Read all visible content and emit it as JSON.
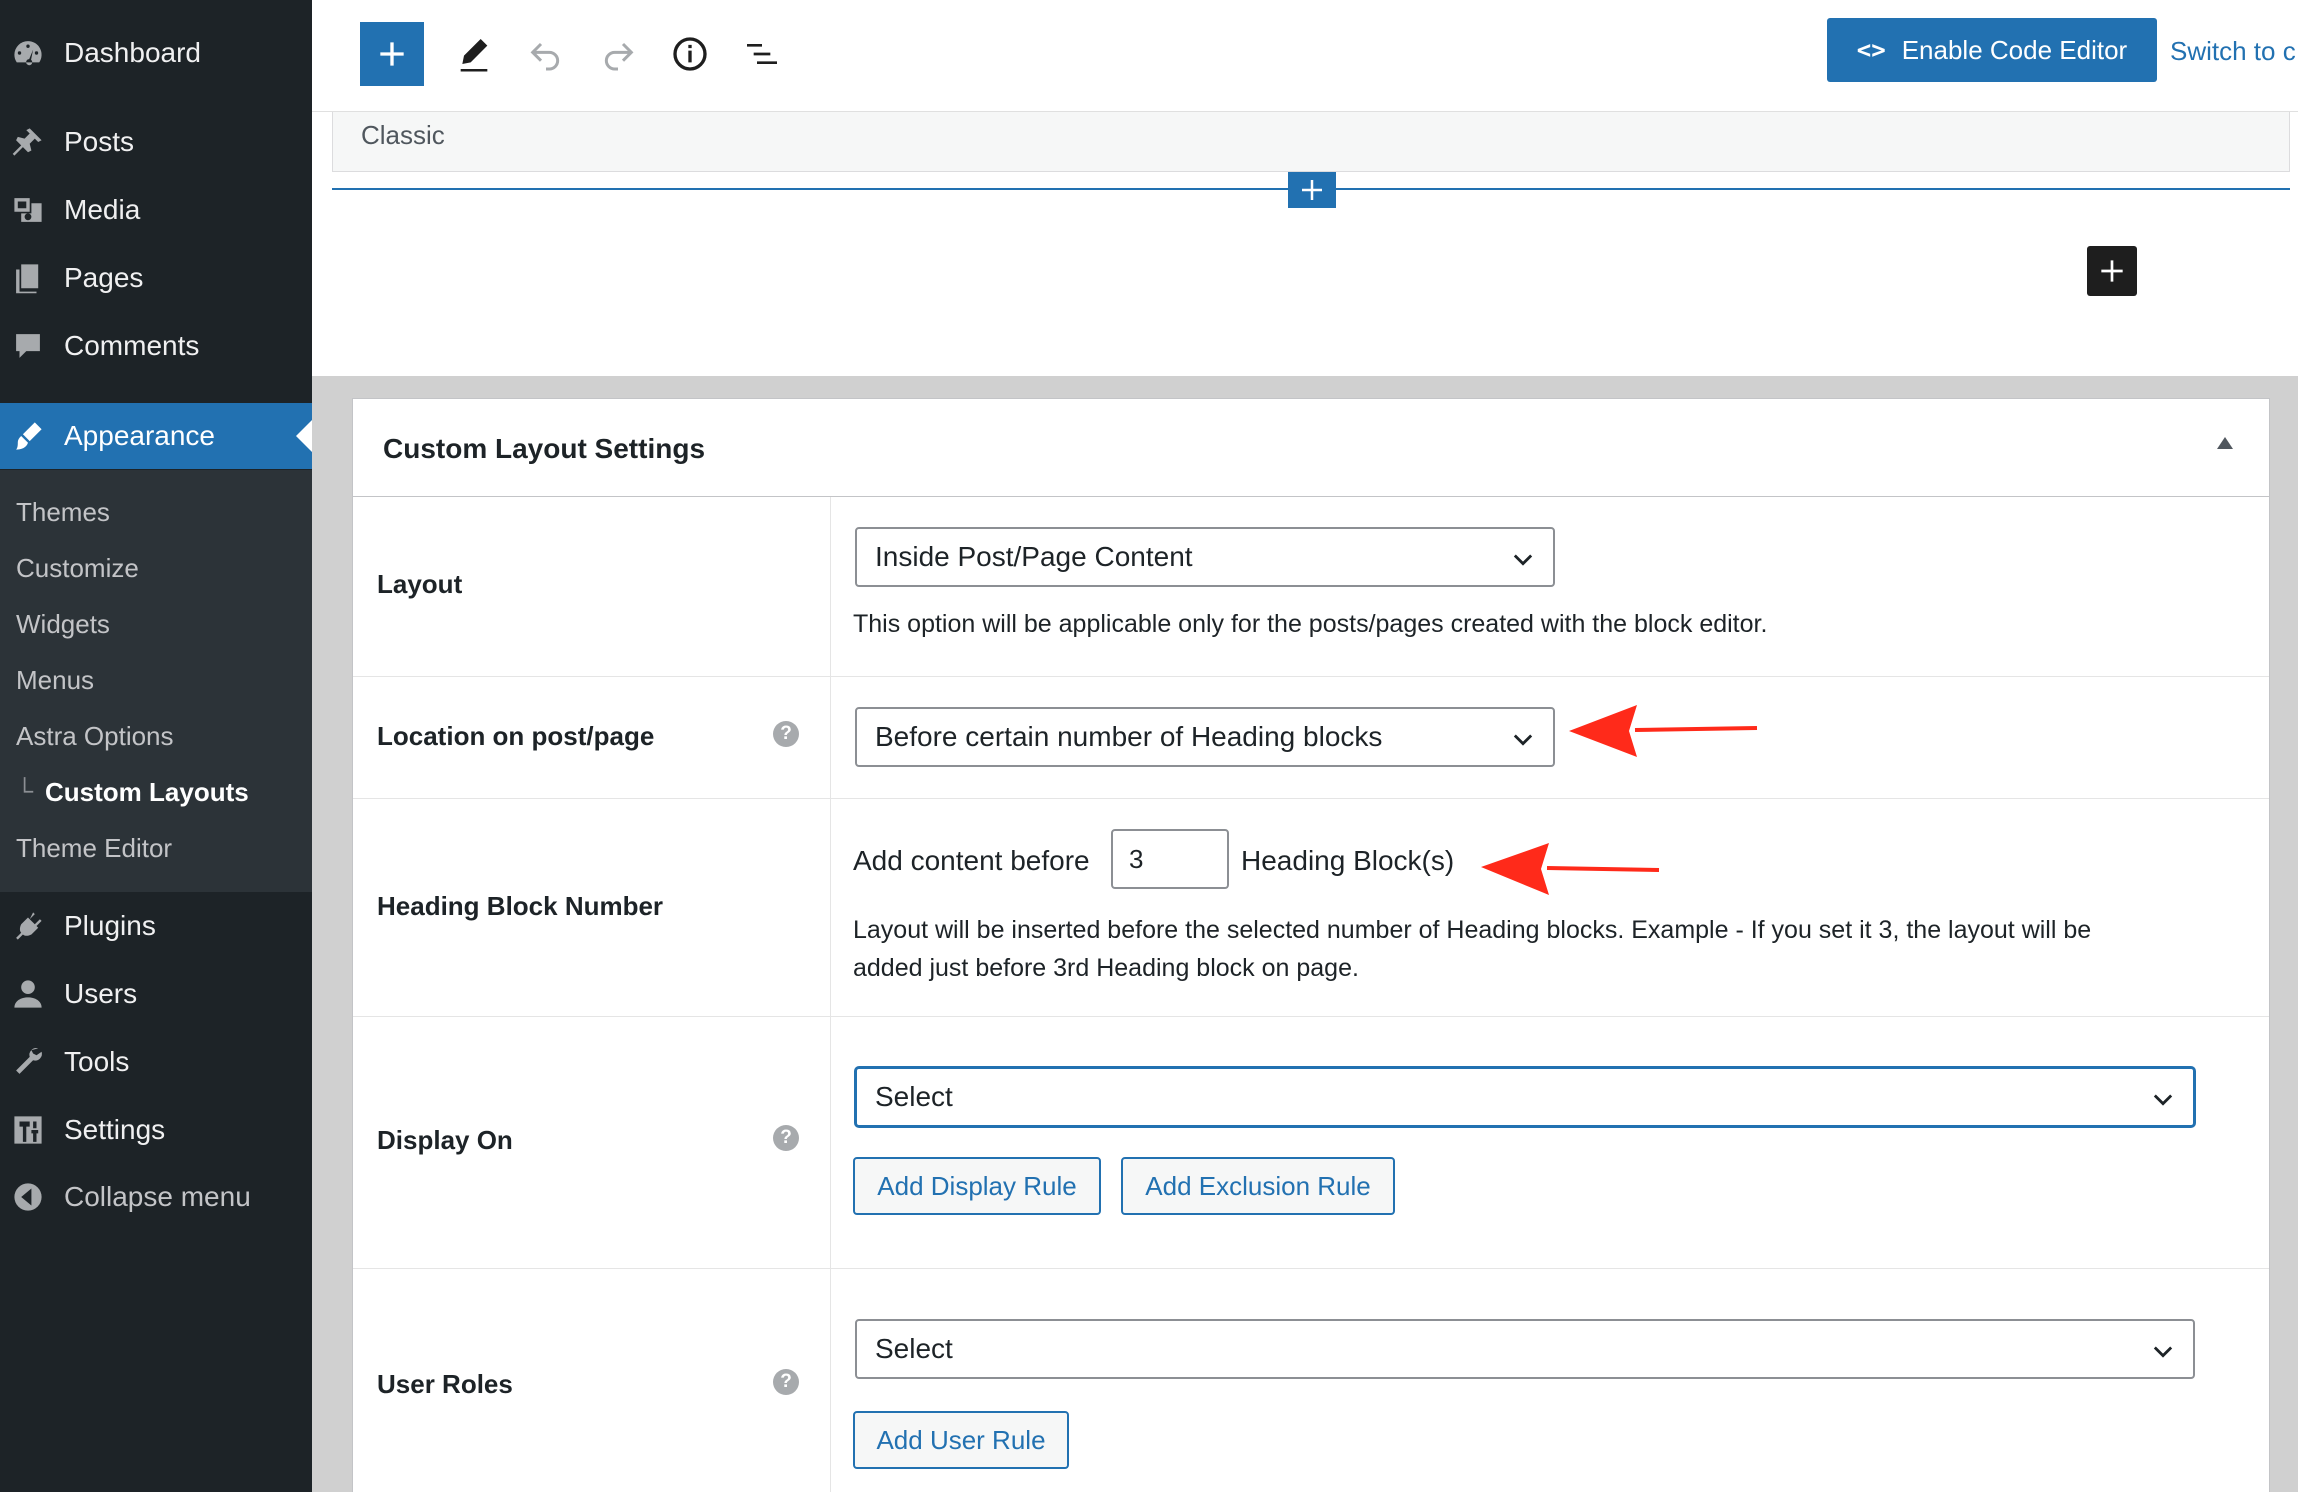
{
  "sidebar": {
    "items_top": [
      {
        "label": "Dashboard",
        "icon": "dashboard-icon"
      },
      {
        "label": "Posts",
        "icon": "pin-icon"
      },
      {
        "label": "Media",
        "icon": "media-icon"
      },
      {
        "label": "Pages",
        "icon": "pages-icon"
      },
      {
        "label": "Comments",
        "icon": "comments-icon"
      }
    ],
    "active": {
      "label": "Appearance",
      "icon": "paintbrush-icon"
    },
    "submenu": [
      "Themes",
      "Customize",
      "Widgets",
      "Menus",
      "Astra Options",
      "Custom Layouts",
      "Theme Editor"
    ],
    "items_bottom": [
      {
        "label": "Plugins",
        "icon": "plugins-icon"
      },
      {
        "label": "Users",
        "icon": "users-icon"
      },
      {
        "label": "Tools",
        "icon": "tools-icon"
      },
      {
        "label": "Settings",
        "icon": "settings-icon"
      }
    ],
    "collapse": "Collapse menu"
  },
  "toolbar": {
    "enable_code_editor": "Enable Code Editor",
    "switch_to": "Switch to c"
  },
  "canvas": {
    "classic_label": "Classic"
  },
  "panel": {
    "title": "Custom Layout Settings",
    "layout": {
      "label": "Layout",
      "value": "Inside Post/Page Content",
      "description": "This option will be applicable only for the posts/pages created with the block editor."
    },
    "location": {
      "label": "Location on post/page",
      "value": "Before certain number of Heading blocks"
    },
    "heading_block": {
      "label": "Heading Block Number",
      "prefix": "Add content before",
      "value": "3",
      "suffix": "Heading Block(s)",
      "description_line1": "Layout will be inserted before the selected number of Heading blocks. Example - If you set it 3, the layout will be",
      "description_line2": "added just before 3rd Heading block on page."
    },
    "display_on": {
      "label": "Display On",
      "value": "Select",
      "add_rule": "Add Display Rule",
      "add_exclusion": "Add Exclusion Rule"
    },
    "user_roles": {
      "label": "User Roles",
      "value": "Select",
      "add_rule": "Add User Rule"
    },
    "help_symbol": "?"
  },
  "colors": {
    "accent": "#2271b1",
    "sidebar_bg": "#1d2327",
    "arrow": "#ff2a1a"
  }
}
